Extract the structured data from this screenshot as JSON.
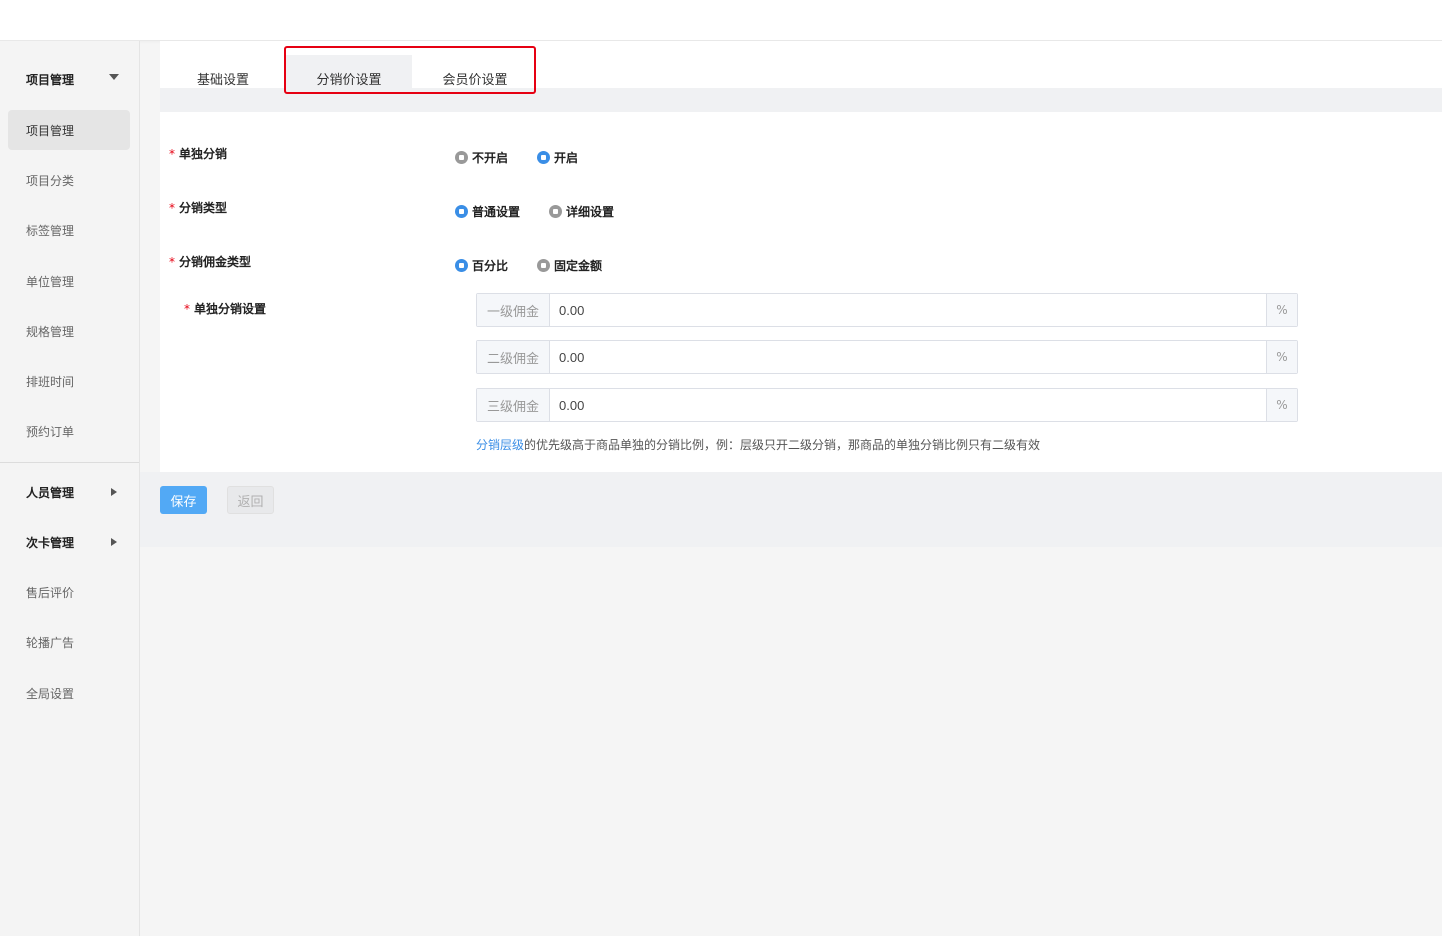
{
  "sidebar": {
    "group_project": "项目管理",
    "items": [
      "项目管理",
      "项目分类",
      "标签管理",
      "单位管理",
      "规格管理",
      "排班时间",
      "预约订单"
    ],
    "group_staff": "人员管理",
    "group_card": "次卡管理",
    "after_sales": "售后评价",
    "carousel": "轮播广告",
    "global_settings": "全局设置"
  },
  "tabs": [
    "基础设置",
    "分销价设置",
    "会员价设置"
  ],
  "form": {
    "standalone_label": "单独分销",
    "standalone_options": [
      "不开启",
      "开启"
    ],
    "standalone_selected": "开启",
    "type_label": "分销类型",
    "type_options": [
      "普通设置",
      "详细设置"
    ],
    "type_selected": "普通设置",
    "commission_type_label": "分销佣金类型",
    "commission_type_options": [
      "百分比",
      "固定金额"
    ],
    "commission_type_selected": "百分比",
    "standalone_settings_label": "单独分销设置",
    "levels": [
      {
        "prefix": "一级佣金",
        "value": "0.00",
        "suffix": "%"
      },
      {
        "prefix": "二级佣金",
        "value": "0.00",
        "suffix": "%"
      },
      {
        "prefix": "三级佣金",
        "value": "0.00",
        "suffix": "%"
      }
    ],
    "hint_link": "分销层级",
    "hint_text": "的优先级高于商品单独的分销比例，例：层级只开二级分销，那商品的单独分销比例只有二级有效"
  },
  "buttons": {
    "save": "保存",
    "back": "返回"
  },
  "colors": {
    "accent": "#3a8ee6",
    "highlight_border": "#e60012",
    "required": "#e60012"
  }
}
